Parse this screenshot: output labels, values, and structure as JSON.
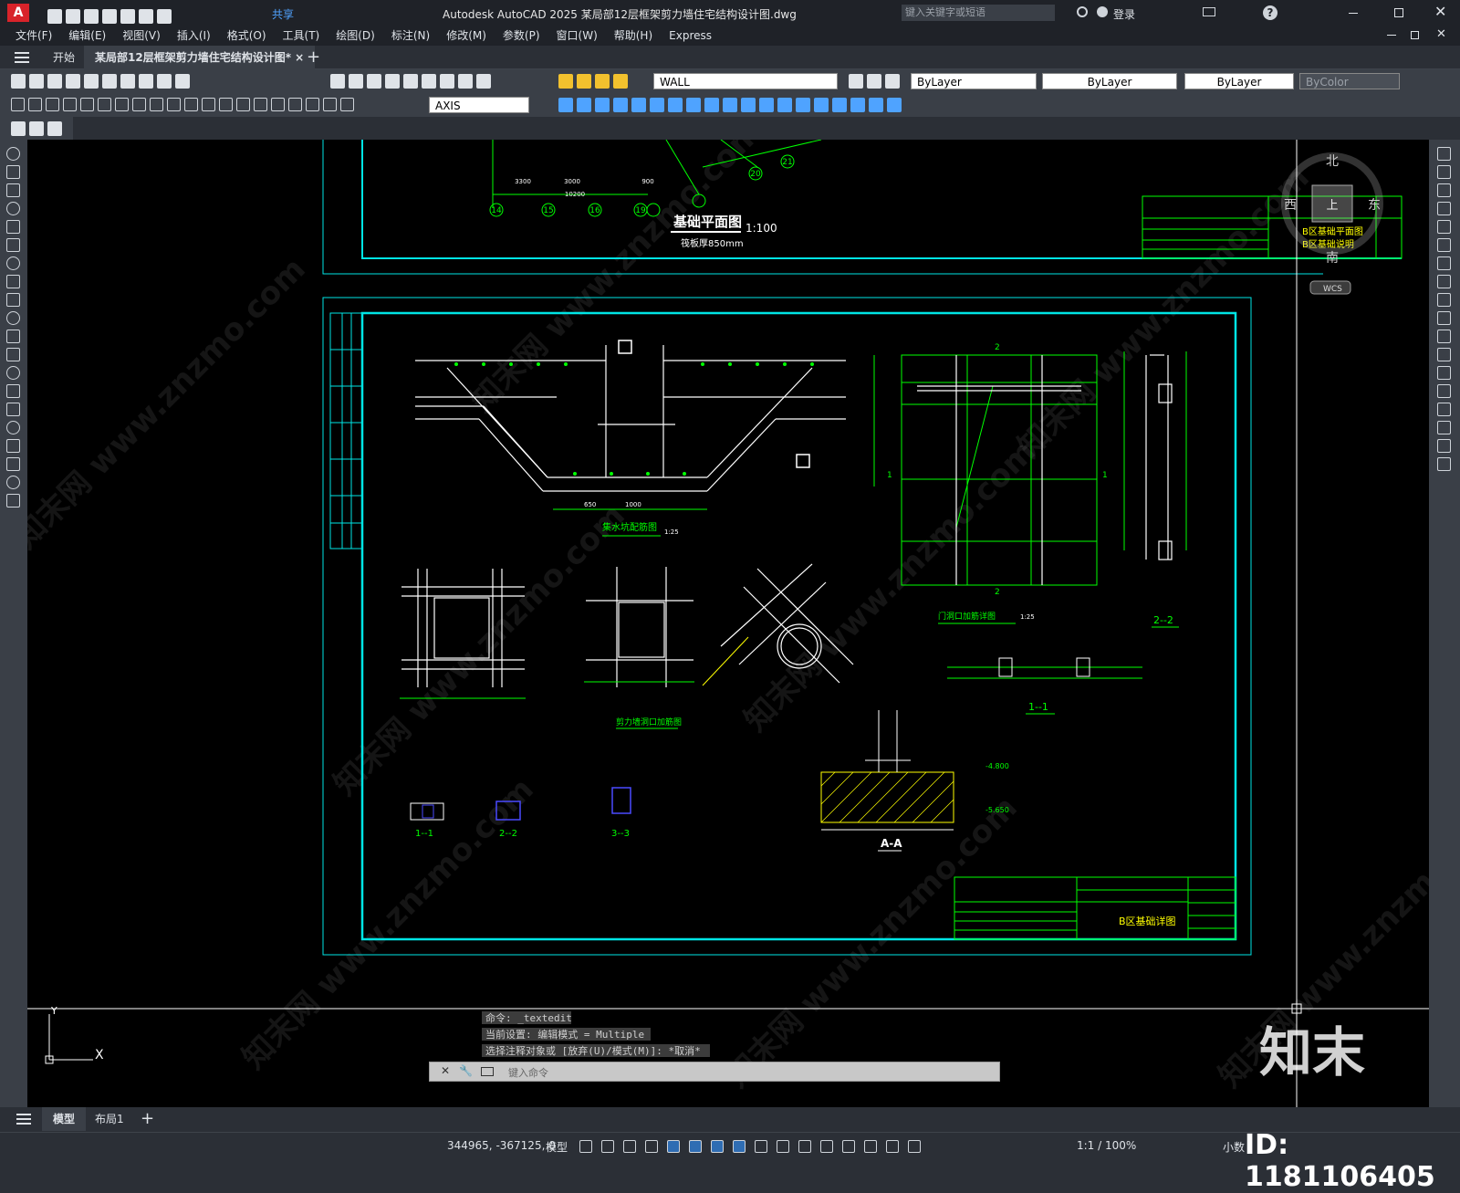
{
  "app": {
    "title": "Autodesk AutoCAD 2025    某局部12层框架剪力墙住宅结构设计图.dwg",
    "search_placeholder": "键入关键字或短语",
    "share_label": "共享",
    "login_label": "登录",
    "logo_letter": "A"
  },
  "menu": [
    "文件(F)",
    "编辑(E)",
    "视图(V)",
    "插入(I)",
    "格式(O)",
    "工具(T)",
    "绘图(D)",
    "标注(N)",
    "修改(M)",
    "参数(P)",
    "窗口(W)",
    "帮助(H)",
    "Express"
  ],
  "doc_tabs": {
    "start": "开始",
    "active": "某局部12层框架剪力墙住宅结构设计图*",
    "close": "×",
    "add": "+"
  },
  "toolbar": {
    "layer_name": "WALL",
    "color": "ByLayer",
    "linetype": "ByLayer",
    "lineweight": "ByLayer",
    "plotstyle": "ByColor",
    "dimstyle": "AXIS"
  },
  "viewcube": {
    "north": "北",
    "south": "南",
    "east": "东",
    "west": "西",
    "top": "上",
    "wcs": "WCS"
  },
  "drawing": {
    "plan_title": "基础平面图",
    "plan_scale": "1:100",
    "plan_note": "筏板厚850mm",
    "axes": [
      "14",
      "15",
      "16",
      "19",
      "20",
      "21",
      "(19)"
    ],
    "dims_top": [
      "3300",
      "3000",
      "10200",
      "900"
    ],
    "sump_title": "集水坑配筋图",
    "sump_scale": "1:25",
    "door_title": "门洞口加筋详图",
    "door_scale": "1:25",
    "wall_open_title": "剪力墙洞口加筋图",
    "section_aa": "A-A",
    "s11": "1--1",
    "s22": "2--2",
    "s1": "1--1",
    "s2": "2--2",
    "s3": "3--3",
    "elev1": "-4.800",
    "elev2": "-5.650",
    "sheet_title_1": "B区基础平面图",
    "sheet_title_1b": "B区基础说明",
    "sheet_title_2": "B区基础详图",
    "dim_650": "650",
    "dim_1000": "1000"
  },
  "command": {
    "history": [
      "命令: _textedit",
      "当前设置: 编辑模式 = Multiple",
      "选择注释对象或 [放弃(U)/模式(M)]: *取消*"
    ],
    "placeholder": "键入命令"
  },
  "layout_tabs": {
    "model": "模型",
    "layout1": "布局1",
    "add": "+"
  },
  "status": {
    "coords": "344965, -367125, 0",
    "space": "模型",
    "scale": "1:1 / 100%",
    "units": "小数"
  },
  "watermark": {
    "brand": "知末",
    "site": "知末网 www.znzmo.com",
    "id": "ID: 1181106405"
  },
  "colors": {
    "cyan": "#00e5e5",
    "green": "#00ff00",
    "yellow": "#ffff00",
    "white": "#ffffff",
    "blue": "#4a4aff",
    "accent": "#d8232a"
  }
}
